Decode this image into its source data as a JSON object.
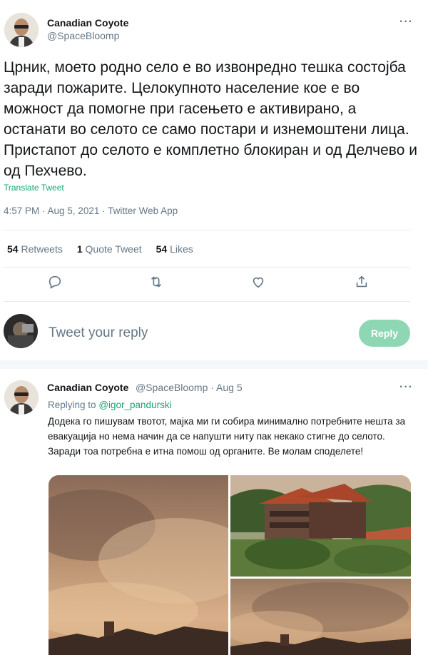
{
  "main_tweet": {
    "author_name": "Canadian Coyote",
    "author_handle": "@SpaceBloomp",
    "more_label": "···",
    "text": "Црник, моето родно село е во извонредно тешка состојба заради пожарите. Целокупното население кое е во можност да помогне при гасењето е активирано, а останати во селото се само постари и изнемоштени лица.  Пристапот до селото е комплетно блокиран и од Делчево и од Пехчево.",
    "translate_label": "Translate Tweet",
    "timestamp": "4:57 PM · Aug 5, 2021 · Twitter Web App",
    "stats": {
      "retweets_count": "54",
      "retweets_label": "Retweets",
      "quote_count": "1",
      "quote_label": "Quote Tweet",
      "likes_count": "54",
      "likes_label": "Likes"
    },
    "actions": [
      "reply-icon",
      "retweet-icon",
      "like-icon",
      "share-icon"
    ]
  },
  "composer": {
    "placeholder": "Tweet your reply",
    "reply_button": "Reply"
  },
  "reply_tweet": {
    "author_name": "Canadian Coyote",
    "author_handle": "@SpaceBloomp",
    "date": "· Aug 5",
    "more_label": "···",
    "replying_prefix": "Replying to",
    "replying_to": "@igor_pandurski",
    "text": "Додека го пишувам твотот, мајка ми ги собира минимално потребните нешта за евакуација но нема начин да се напушти ниту пак некако стигне до селото. Заради тоа потребна е итна помош од органите. Ве молам споделете!",
    "media": [
      "smoke-sky-photo",
      "village-houses-photo",
      "smoke-over-village-photo"
    ]
  },
  "colors": {
    "accent": "#17a673",
    "reply_button_bg": "#8ed7b5",
    "muted_text": "#657786"
  }
}
